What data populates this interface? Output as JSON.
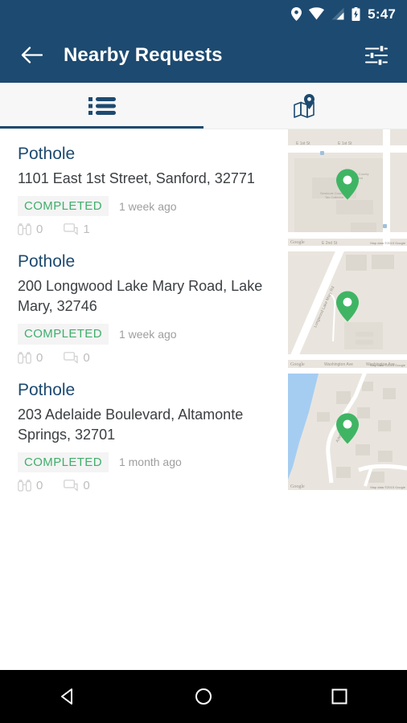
{
  "status_bar": {
    "time": "5:47",
    "icons": [
      "location-pin-icon",
      "wifi-icon",
      "signal-icon",
      "battery-charging-icon"
    ]
  },
  "app_bar": {
    "title": "Nearby Requests",
    "back_icon": "arrow-back-icon",
    "filter_icon": "filter-tune-icon",
    "background_color": "#1d4a70"
  },
  "tabs": [
    {
      "name": "list-tab",
      "icon": "list-icon",
      "active": true
    },
    {
      "name": "map-tab",
      "icon": "map-pin-icon",
      "active": false
    }
  ],
  "theme": {
    "primary": "#1d4a70",
    "status_green": "#3fae6b",
    "badge_bg": "#f4f4f4",
    "marker_green": "#3fb564"
  },
  "requests": [
    {
      "title": "Pothole",
      "address": "1101  East 1st Street, Sanford, 32771",
      "status": "COMPLETED",
      "time": "1 week ago",
      "watch_count": "0",
      "comment_count": "1",
      "map": {
        "labels": [
          "E 1st St",
          "E 1st St",
          "E 2nd St",
          "Seminole County Tax Collector",
          "Seminole County Department"
        ],
        "attribution": "Map data ©2015 Google",
        "logo": "Google"
      }
    },
    {
      "title": "Pothole",
      "address": "200  Longwood Lake Mary Road, Lake Mary, 32746",
      "status": "COMPLETED",
      "time": "1 week ago",
      "watch_count": "0",
      "comment_count": "0",
      "map": {
        "labels": [
          "Longwood Lake Mary Rd",
          "Washington Ave",
          "Washington Ave"
        ],
        "attribution": "Map data ©2015 Google",
        "logo": "Google"
      }
    },
    {
      "title": "Pothole",
      "address": "203  Adelaide Boulevard, Altamonte Springs, 32701",
      "status": "COMPLETED",
      "time": "1 month ago",
      "watch_count": "0",
      "comment_count": "0",
      "map": {
        "labels": [
          "Adelaide Blvd"
        ],
        "attribution": "Map data ©2015 Google",
        "logo": "Google"
      }
    }
  ],
  "nav_bar": {
    "back_icon": "nav-back-triangle-icon",
    "home_icon": "nav-home-circle-icon",
    "recents_icon": "nav-recents-square-icon"
  }
}
